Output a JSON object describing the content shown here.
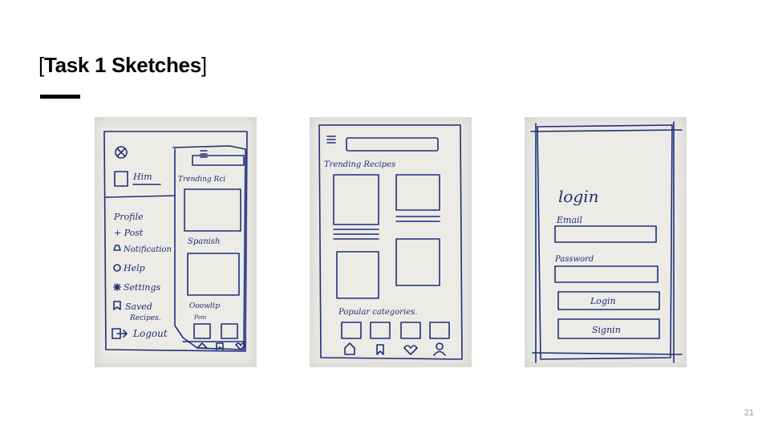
{
  "slide": {
    "title_open": "[",
    "title_main": "Task 1 Sketches",
    "title_close": "]",
    "page_number": "21"
  },
  "sketch_1": {
    "user": "Him",
    "panel_heading": "Trending Rci",
    "menu": [
      "Profile",
      "+ Post",
      "Notification",
      "Help",
      "Settings",
      "Saved",
      "Recipes.",
      "Logout"
    ],
    "card_1": "Spanish",
    "card_2": "Ooowltp",
    "card_2_sub": "Pom"
  },
  "sketch_2": {
    "heading": "Trending Recipes",
    "categories": "Popular categories."
  },
  "sketch_3": {
    "heading": "login",
    "email_label": "Email",
    "password_label": "Password",
    "login_button": "Login",
    "signin_button": "Signin"
  }
}
